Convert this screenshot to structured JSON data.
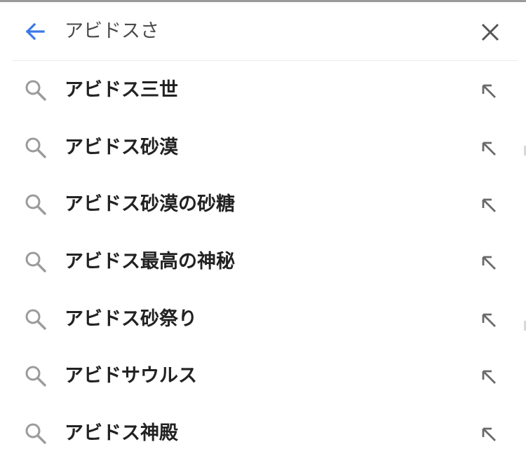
{
  "search": {
    "query": "アビドスさ",
    "back_icon": "arrow-left-icon",
    "clear_icon": "close-icon",
    "back_color": "#3b78e7"
  },
  "suggestions": [
    {
      "text": "アビドス三世"
    },
    {
      "text": "アビドス砂漠"
    },
    {
      "text": "アビドス砂漠の砂糖"
    },
    {
      "text": "アビドス最高の神秘"
    },
    {
      "text": "アビドス砂祭り"
    },
    {
      "text": "アビドサウルス"
    },
    {
      "text": "アビドス神殿"
    }
  ],
  "icons": {
    "suggestion_leading": "search-icon",
    "suggestion_trailing": "arrow-up-left-icon"
  }
}
